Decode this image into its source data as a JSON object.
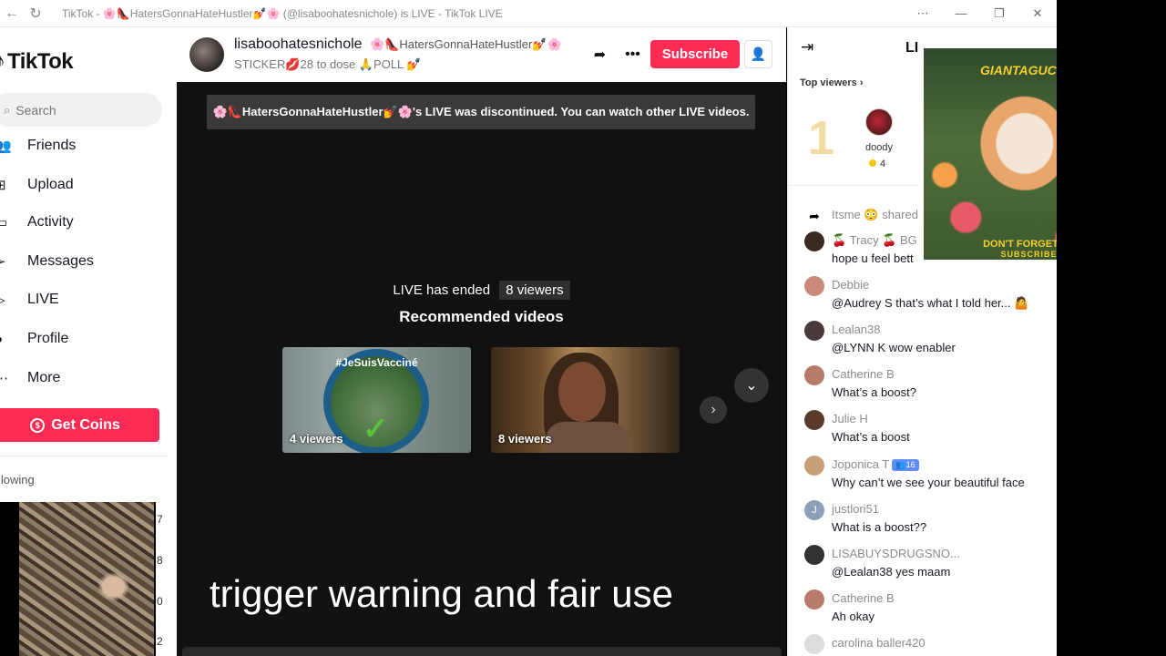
{
  "window": {
    "title": "TikTok - 🌸👠HatersGonnaHateHustler💅🌸 (@lisaboohatesnichole) is LIVE - TikTok LIVE",
    "controls": [
      "⋯",
      "—",
      "❐",
      "✕"
    ]
  },
  "sidebar": {
    "logo": "TikTok",
    "search_placeholder": "Search",
    "nav": [
      {
        "label": "Friends",
        "icon": "friends-icon"
      },
      {
        "label": "Upload",
        "icon": "upload-icon"
      },
      {
        "label": "Activity",
        "icon": "activity-icon"
      },
      {
        "label": "Messages",
        "icon": "messages-icon"
      },
      {
        "label": "LIVE",
        "icon": "live-icon"
      },
      {
        "label": "Profile",
        "icon": "profile-icon"
      },
      {
        "label": "More",
        "icon": "more-icon"
      }
    ],
    "get_coins": "Get Coins",
    "following_label": "llowing",
    "following_counts": [
      "7",
      "8",
      "0",
      "2"
    ]
  },
  "stream": {
    "username": "lisaboohatesnichole",
    "display_suffix": "🌸👠HatersGonnaHateHustler💅🌸",
    "sticker_line": "STICKER💋28 to dose 🙏POLL 💅",
    "subscribe_label": "Subscribe",
    "banner": "🌸👠HatersGonnaHateHustler💅🌸's LIVE was discontinued. You can watch other LIVE videos.",
    "ended_label": "LIVE has ended",
    "viewers_badge": "8 viewers",
    "recommended_label": "Recommended videos",
    "recommended": [
      {
        "viewers": "4 viewers",
        "overlay_text": "#JeSuisVacciné"
      },
      {
        "viewers": "8 viewers"
      }
    ],
    "caption": "trigger warning and fair use"
  },
  "chat": {
    "title": "LI",
    "top_viewers_label": "Top viewers",
    "top_viewer": {
      "rank": "1",
      "name": "doody",
      "coins": "4"
    },
    "messages": [
      {
        "name": "Itsme 😳 shared",
        "text": "",
        "avatar": "#e8e8e8",
        "kind": "share"
      },
      {
        "name": "🍒 Tracy 🍒 BG",
        "text": "hope u feel bett",
        "avatar": "#3a2a20"
      },
      {
        "name": "Debbie",
        "text": "@Audrey S that’s what I told her... 🤷",
        "avatar": "#c98a7a"
      },
      {
        "name": "Lealan38",
        "text": "@LYNN K wow enabler",
        "avatar": "#4a3a3a"
      },
      {
        "name": "Catherine B",
        "text": "What’s a boost?",
        "avatar": "#b87a6a"
      },
      {
        "name": "Julie H",
        "text": "What’s a boost",
        "avatar": "#5a3a2a"
      },
      {
        "name": "Joponica T",
        "level": "16",
        "text": "Why can’t we see your beautiful face",
        "avatar": "#c7a07a"
      },
      {
        "name": "justlori51",
        "text": "What is a boost??",
        "avatar": "#8aa0b8",
        "initial": "J"
      },
      {
        "name": "LISABUYSDRUGSNO...",
        "text": "@Lealan38 yes maam",
        "avatar": "#333333"
      },
      {
        "name": "Catherine B",
        "text": "Ah okay",
        "avatar": "#b87a6a"
      },
      {
        "name": "carolina baller420",
        "text": "",
        "avatar": "#dddddd"
      }
    ]
  },
  "overlay": {
    "brand": "GIANTAGUCCI",
    "line1": "DON'T FORGET TO",
    "line2": "SUBSCRIBE"
  },
  "colors": {
    "accent": "#fe2c55",
    "video_bg": "#111111",
    "level_badge": "#5f8cff"
  }
}
